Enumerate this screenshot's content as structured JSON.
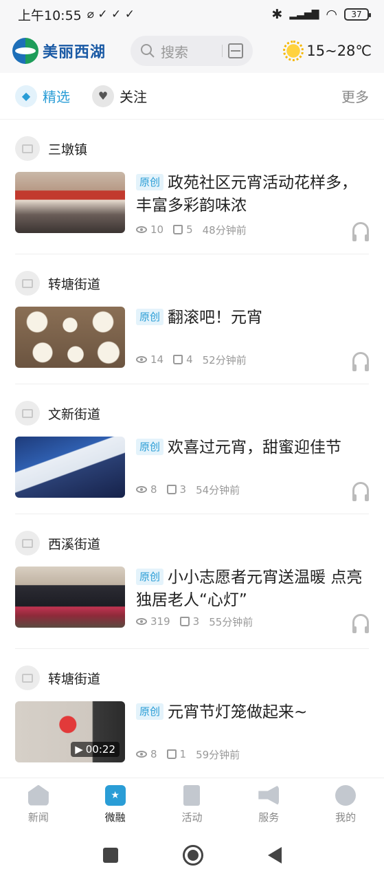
{
  "status_bar": {
    "time": "上午10:55",
    "extra_icons": "⌀ ✓ ✓ ✓",
    "battery": "37"
  },
  "header": {
    "logo_text": "美丽西湖",
    "search_placeholder": "搜索",
    "weather": "15~28℃"
  },
  "tabs": {
    "featured": "精选",
    "follow": "关注",
    "more": "更多"
  },
  "feed": [
    {
      "source": "三墩镇",
      "badge": "原创",
      "title": "政苑社区元宵活动花样多，丰富多彩韵味浓",
      "views": "10",
      "likes": "5",
      "time": "48分钟前"
    },
    {
      "source": "转塘街道",
      "badge": "原创",
      "title": "翻滚吧！元宵",
      "views": "14",
      "likes": "4",
      "time": "52分钟前"
    },
    {
      "source": "文新街道",
      "badge": "原创",
      "title": "欢喜过元宵，甜蜜迎佳节",
      "views": "8",
      "likes": "3",
      "time": "54分钟前"
    },
    {
      "source": "西溪街道",
      "badge": "原创",
      "title": "小小志愿者元宵送温暖 点亮独居老人“心灯”",
      "views": "319",
      "likes": "3",
      "time": "55分钟前"
    },
    {
      "source": "转塘街道",
      "badge": "原创",
      "title": "元宵节灯笼做起来~",
      "views": "8",
      "likes": "1",
      "time": "59分钟前",
      "video_duration": "00:22"
    }
  ],
  "bottom_nav": {
    "news": "新闻",
    "micro": "微融",
    "activity": "活动",
    "service": "服务",
    "mine": "我的"
  },
  "colors": {
    "accent": "#2a9dd6",
    "badge_bg": "#e4f3fb",
    "meta": "#999999"
  }
}
